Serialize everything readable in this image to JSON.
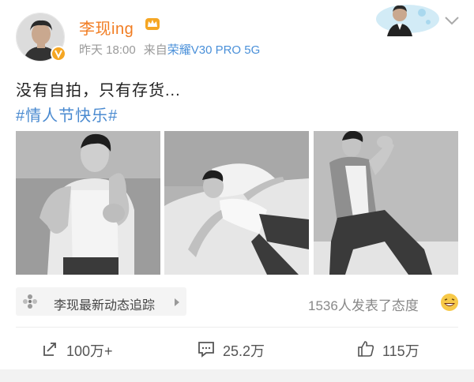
{
  "post": {
    "user": {
      "name": "李现ing",
      "avatar_icon": "avatar-portrait",
      "badge_icon": "verified-v-icon",
      "vip_icon": "crown-icon"
    },
    "meta": {
      "time": "昨天 18:00",
      "source_prefix": "来自",
      "device": "荣耀V30 PRO 5G"
    },
    "text": "没有自拍，只有存货...",
    "hashtag": "#情人节快乐#",
    "images": [
      {
        "icon": "photo-boxing-pose"
      },
      {
        "icon": "photo-lying-on-bed"
      },
      {
        "icon": "photo-kneeling-pose"
      }
    ],
    "tracker": {
      "label": "李现最新动态追踪",
      "icon": "pinwheel-icon",
      "arrow_icon": "triangle-right-icon"
    },
    "reactions": {
      "text": "1536人发表了态度",
      "emoji": "laughing-emoji"
    },
    "actions": {
      "repost": "100万+",
      "comment": "25.2万",
      "like": "115万"
    },
    "colors": {
      "username": "#f17c21",
      "device": "#4a90d9",
      "hashtag": "#4a8ad0",
      "meta": "#9a9a9a"
    }
  }
}
